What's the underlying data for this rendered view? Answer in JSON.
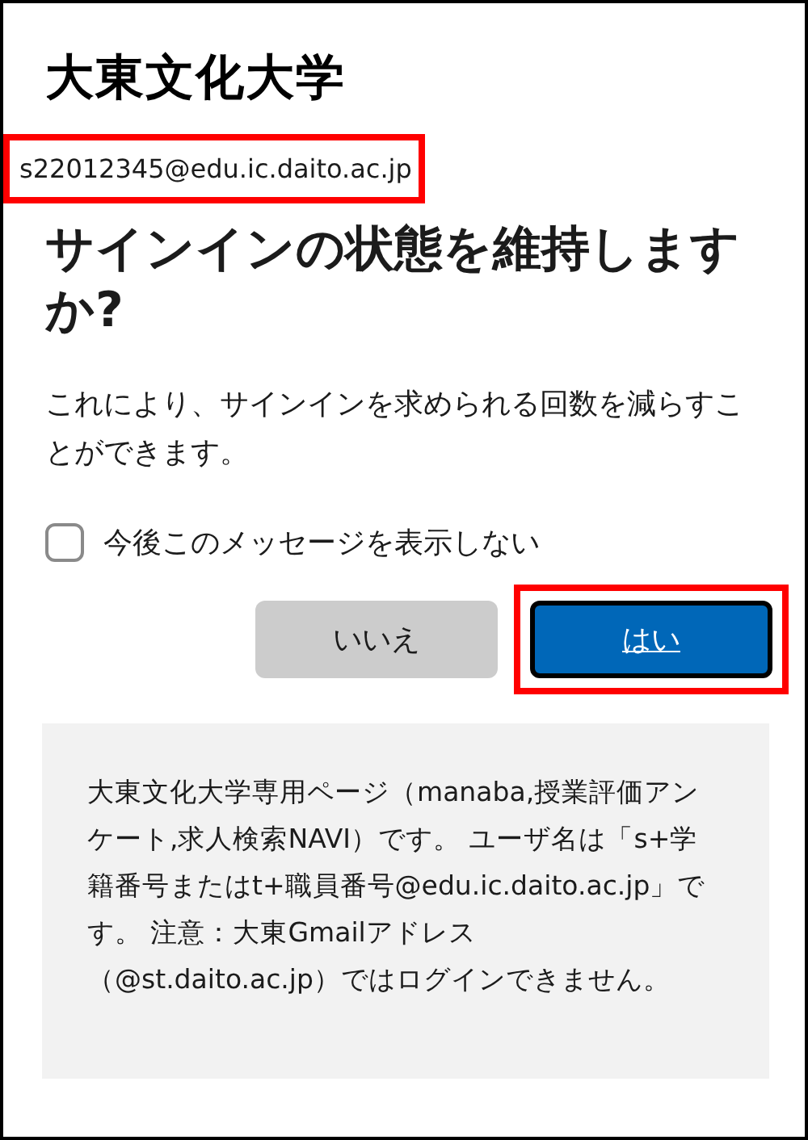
{
  "logo": "大東文化大学",
  "account_email": {
    "text": "s22012345@edu.ic.daito.ac.jp",
    "highlighted": true
  },
  "title": "サインインの状態を維持しますか?",
  "description": "これにより、サインインを求められる回数を減らすことができます。",
  "checkbox": {
    "label": "今後このメッセージを表示しない",
    "checked": false
  },
  "buttons": [
    {
      "label": "いいえ",
      "kind": "secondary",
      "highlighted": false
    },
    {
      "label": "はい",
      "kind": "primary",
      "highlighted": true
    }
  ],
  "info_text": "大東文化大学専用ページ（manaba,授業評価アンケート,求人検索NAVI）です。 ユーザ名は「s+学籍番号またはt+職員番号@edu.ic.daito.ac.jp」です。 注意：大東Gmailアドレス（@st.daito.ac.jp）ではログインできません。"
}
